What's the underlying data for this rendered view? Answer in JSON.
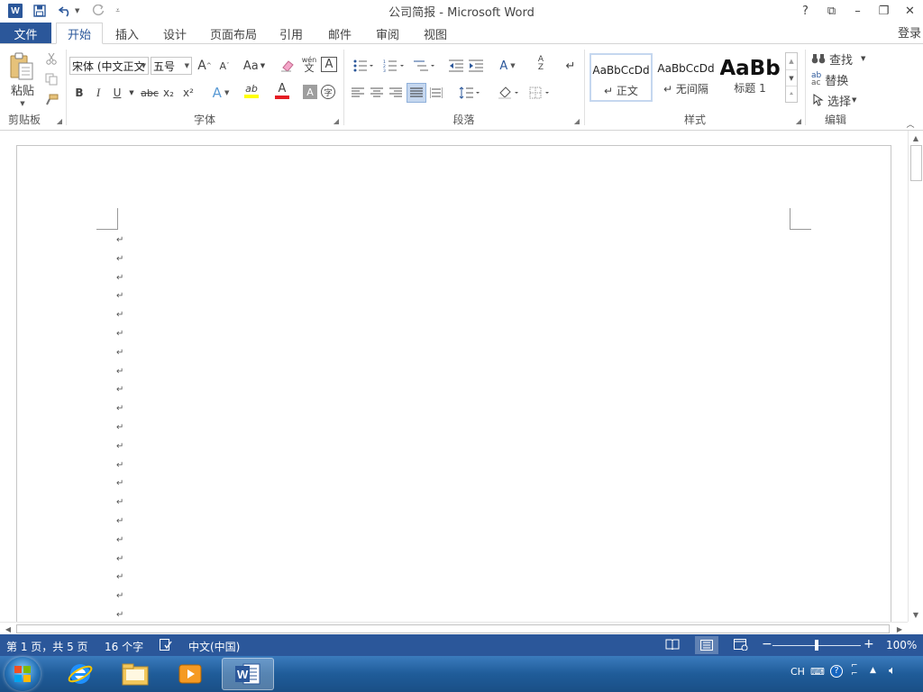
{
  "window": {
    "title": "公司简报 - Microsoft Word",
    "app_icon_letter": "W",
    "controls": [
      "?",
      "⧉",
      "–",
      "❐",
      "✕"
    ]
  },
  "tabs": [
    {
      "label": "文件",
      "active": false,
      "file": true
    },
    {
      "label": "开始",
      "active": true
    },
    {
      "label": "插入",
      "active": false
    },
    {
      "label": "设计",
      "active": false
    },
    {
      "label": "页面布局",
      "active": false
    },
    {
      "label": "引用",
      "active": false
    },
    {
      "label": "邮件",
      "active": false
    },
    {
      "label": "审阅",
      "active": false
    },
    {
      "label": "视图",
      "active": false
    }
  ],
  "login": "登录",
  "ribbon": {
    "clipboard": {
      "label": "剪贴板",
      "paste": "粘贴"
    },
    "font": {
      "label": "字体",
      "font_name": "宋体 (中文正文",
      "font_size": "五号",
      "bold": "B",
      "italic": "I",
      "underline": "U",
      "strike": "abc",
      "subscript": "x₂",
      "superscript": "x²",
      "grow": "A",
      "shrink": "A",
      "case": "Aa",
      "phonetic": "wén",
      "border_char": "A",
      "effect": "A",
      "highlight": "ab",
      "font_color": "A",
      "shade": "A",
      "enclose": "字"
    },
    "paragraph": {
      "label": "段落",
      "sort": "A↓Z"
    },
    "styles": {
      "label": "样式",
      "items": [
        {
          "preview": "AaBbCcDd",
          "name": "正文",
          "selected": true
        },
        {
          "preview": "AaBbCcDd",
          "name": "无间隔",
          "selected": false
        },
        {
          "preview": "AaBb",
          "name": "标题 1",
          "selected": false
        }
      ]
    },
    "editing": {
      "label": "编辑",
      "find": "查找",
      "replace": "替换",
      "select": "选择"
    }
  },
  "document": {
    "paragraph_mark": "↵",
    "empty_paragraphs": 21
  },
  "statusbar": {
    "page": "第 1 页，共 5 页",
    "words": "16 个字",
    "language": "中文(中国)",
    "zoom": "100%",
    "zoom_fraction": 0.5
  },
  "taskbar": {
    "tray_lang": "CH"
  },
  "colors": {
    "accent": "#2b579a"
  }
}
